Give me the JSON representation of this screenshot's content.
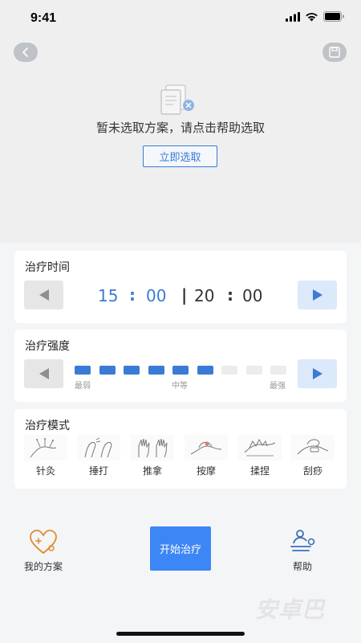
{
  "status": {
    "time": "9:41"
  },
  "empty": {
    "message": "暂未选取方案，请点击帮助选取",
    "button": "立即选取"
  },
  "time_card": {
    "title": "治疗时间",
    "start_hour": "15",
    "start_min": "00",
    "sep": ":",
    "divider": "|",
    "end_hour": "20",
    "end_min": "00"
  },
  "intensity_card": {
    "title": "治疗强度",
    "level": 6,
    "max": 9,
    "label_min": "最弱",
    "label_mid": "中等",
    "label_max": "最强",
    "active_color": "#3a7bd5",
    "inactive_color": "#ececec"
  },
  "mode_card": {
    "title": "治疗模式",
    "modes": [
      "针灸",
      "捶打",
      "推拿",
      "按摩",
      "揉捏",
      "刮痧"
    ]
  },
  "bottom": {
    "plan": "我的方案",
    "start": "开始治疗",
    "help": "帮助"
  },
  "watermark": "安卓巴"
}
